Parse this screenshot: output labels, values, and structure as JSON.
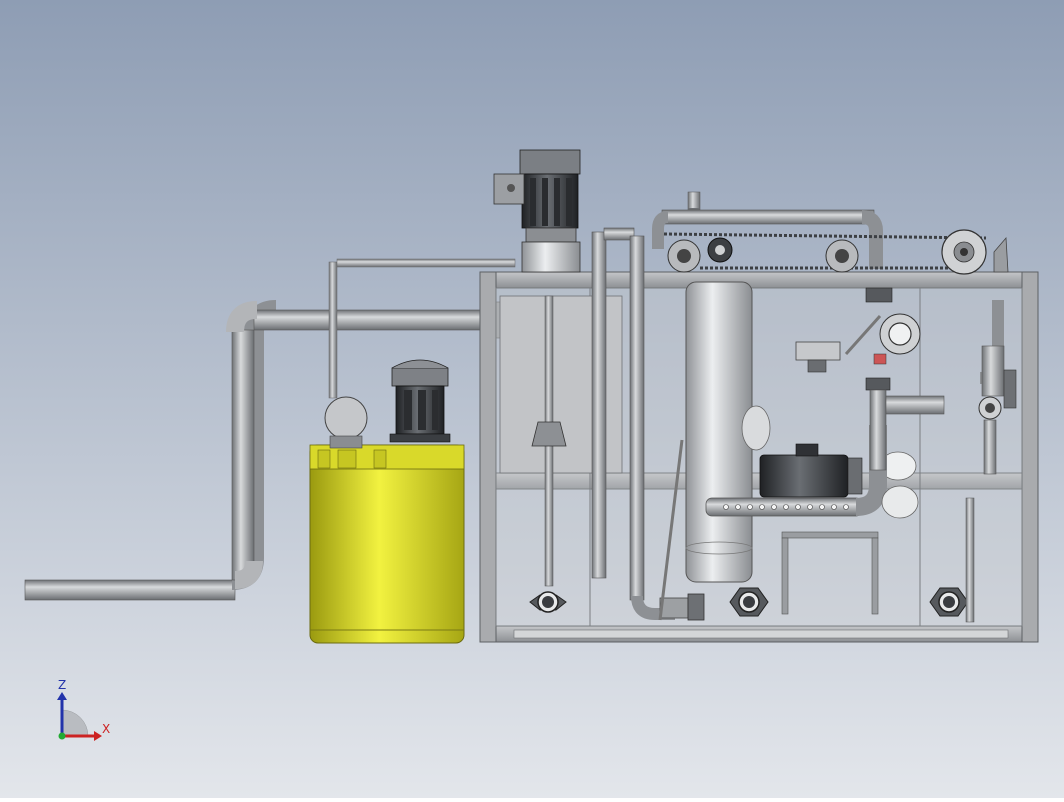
{
  "viewport": {
    "background_top": "#8e9db4",
    "background_bottom": "#e3e6eb"
  },
  "triad": {
    "z_label": "Z",
    "x_label": "X",
    "z_color": "#2233aa",
    "x_color": "#cc2222"
  },
  "colors": {
    "pipe": "#9a9da1",
    "frame": "#a7a9ac",
    "frame_dark": "#6f7276",
    "tank_yellow": "#e6e62a",
    "motor_dark": "#3c3f43",
    "tank_steel": "#c9cbcf"
  }
}
